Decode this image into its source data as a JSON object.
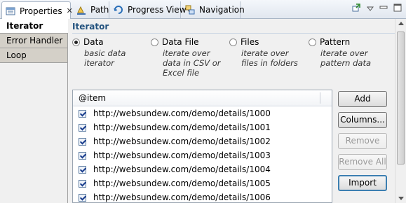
{
  "tabs": [
    {
      "label": "Properties",
      "icon": "properties-icon",
      "active": true,
      "closable": true
    },
    {
      "label": "Path",
      "icon": "path-icon",
      "active": false
    },
    {
      "label": "Progress View",
      "icon": "progress-view-icon",
      "active": false
    },
    {
      "label": "Navigation",
      "icon": "navigation-icon",
      "active": false
    }
  ],
  "toolbar_icons": [
    "pin-icon",
    "view-menu-icon",
    "minimize-icon",
    "maximize-icon"
  ],
  "sidebar": {
    "items": [
      {
        "label": "Iterator",
        "active": true
      },
      {
        "label": "Error Handler",
        "active": false
      },
      {
        "label": "Loop",
        "active": false
      }
    ]
  },
  "section": {
    "title": "Iterator"
  },
  "iterator_options": [
    {
      "label": "Data",
      "description": "basic data iterator",
      "selected": true
    },
    {
      "label": "Data File",
      "description": "iterate over data in CSV or Excel file",
      "selected": false
    },
    {
      "label": "Files",
      "description": "iterate over files in folders",
      "selected": false
    },
    {
      "label": "Pattern",
      "description": "iterate over pattern data",
      "selected": false
    }
  ],
  "table": {
    "header": "@item",
    "rows": [
      {
        "value": "http://websundew.com/demo/details/1000",
        "checked": true
      },
      {
        "value": "http://websundew.com/demo/details/1001",
        "checked": true
      },
      {
        "value": "http://websundew.com/demo/details/1002",
        "checked": true
      },
      {
        "value": "http://websundew.com/demo/details/1003",
        "checked": true
      },
      {
        "value": "http://websundew.com/demo/details/1004",
        "checked": true
      },
      {
        "value": "http://websundew.com/demo/details/1005",
        "checked": true
      },
      {
        "value": "http://websundew.com/demo/details/1006",
        "checked": true
      }
    ]
  },
  "buttons": {
    "add": "Add",
    "columns": "Columns...",
    "remove": "Remove",
    "remove_all": "Remove All",
    "import": "Import"
  },
  "colors": {
    "section_title": "#23527e",
    "focus_border": "#3c7fb1"
  }
}
